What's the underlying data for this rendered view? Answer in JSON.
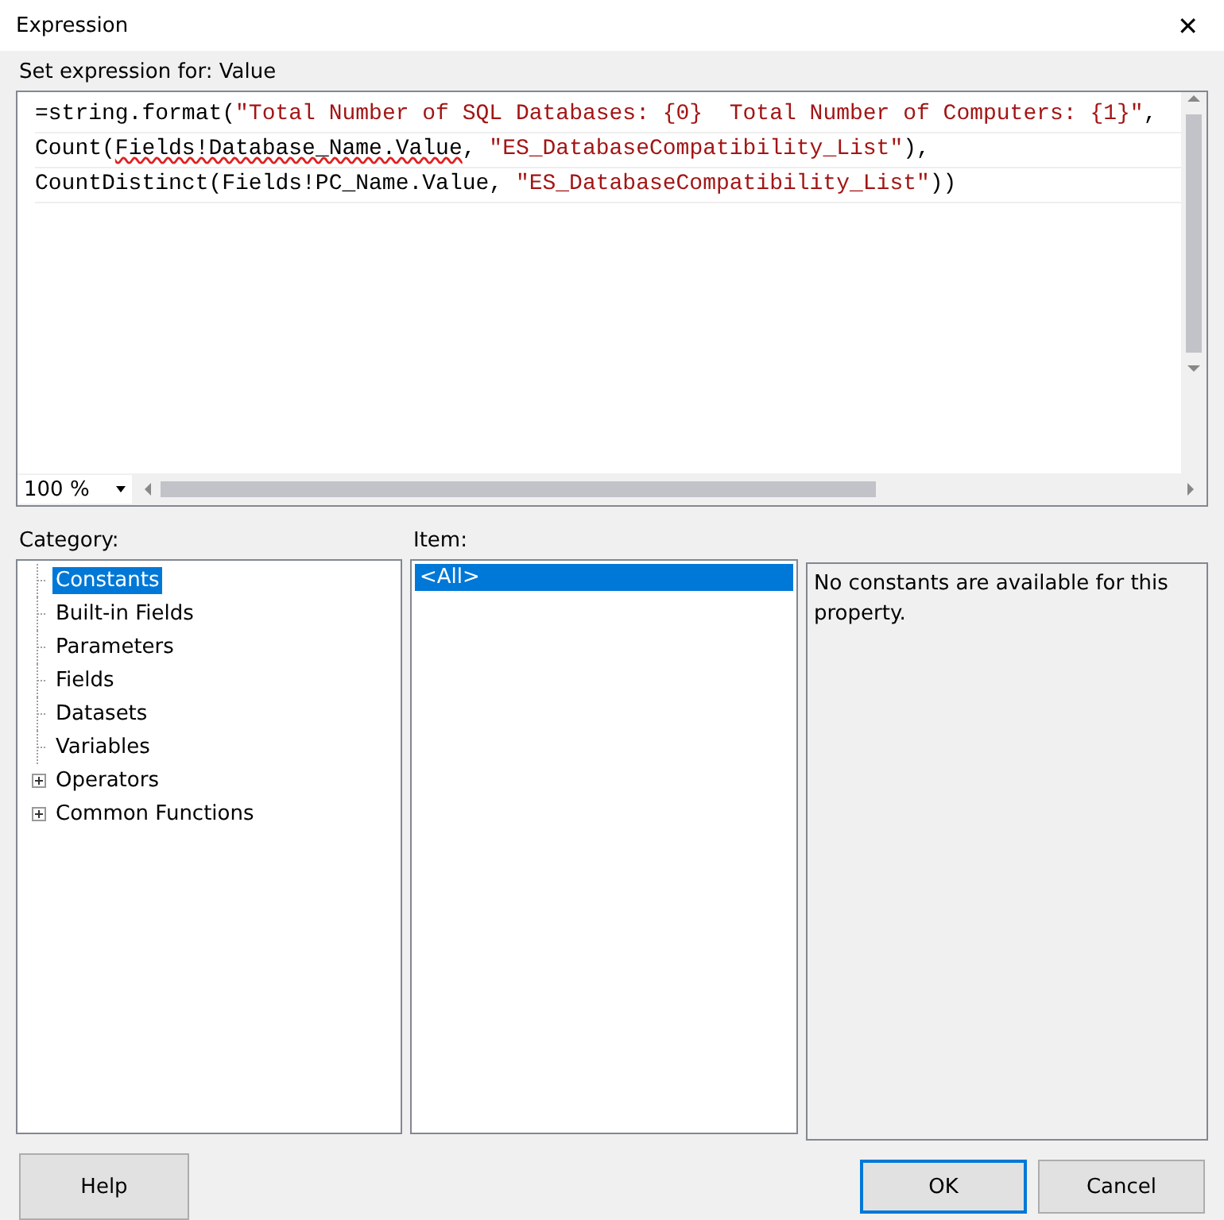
{
  "window": {
    "title": "Expression",
    "close": "✕"
  },
  "expression": {
    "label": "Set expression for: Value",
    "lines": [
      [
        {
          "kind": "plain",
          "text": "=string.format("
        },
        {
          "kind": "string",
          "text": "\"Total Number of SQL Databases: {0}  Total Number of Computers: {1}\""
        },
        {
          "kind": "plain",
          "text": ","
        }
      ],
      [
        {
          "kind": "plain",
          "text": "Count("
        },
        {
          "kind": "error",
          "text": "Fields!Database_Name.Value"
        },
        {
          "kind": "plain",
          "text": ", "
        },
        {
          "kind": "string",
          "text": "\"ES_DatabaseCompatibility_List\""
        },
        {
          "kind": "plain",
          "text": "),"
        }
      ],
      [
        {
          "kind": "plain",
          "text": "CountDistinct(Fields!PC_Name.Value, "
        },
        {
          "kind": "string",
          "text": "\"ES_DatabaseCompatibility_List\""
        },
        {
          "kind": "plain",
          "text": "))"
        }
      ]
    ],
    "zoom": "100 %"
  },
  "category": {
    "label": "Category:",
    "items": [
      {
        "label": "Constants",
        "kind": "leaf",
        "selected": true
      },
      {
        "label": "Built-in Fields",
        "kind": "leaf",
        "selected": false
      },
      {
        "label": "Parameters",
        "kind": "leaf",
        "selected": false
      },
      {
        "label": "Fields",
        "kind": "leaf",
        "selected": false
      },
      {
        "label": "Datasets",
        "kind": "leaf",
        "selected": false
      },
      {
        "label": "Variables",
        "kind": "leaf",
        "selected": false
      },
      {
        "label": "Operators",
        "kind": "folder",
        "selected": false
      },
      {
        "label": "Common Functions",
        "kind": "folder",
        "selected": false
      }
    ]
  },
  "item": {
    "label": "Item:",
    "items": [
      {
        "label": "<All>",
        "selected": true
      }
    ]
  },
  "description": "No constants are available for this property.",
  "buttons": [
    {
      "label": "Help",
      "kind": "help"
    },
    {
      "label": "OK",
      "kind": "default"
    },
    {
      "label": "Cancel",
      "kind": "normal"
    }
  ]
}
